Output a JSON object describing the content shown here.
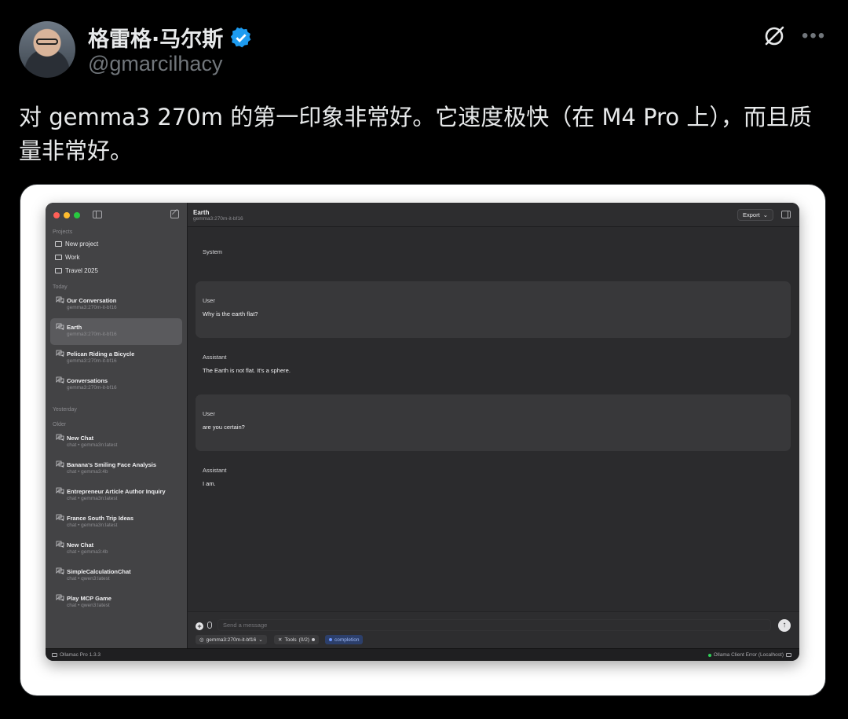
{
  "tweet": {
    "display_name": "格雷格·马尔斯",
    "handle": "@gmarcilhacy",
    "text": "对 gemma3 270m 的第一印象非常好。它速度极快（在 M4 Pro 上），而且质量非常好。"
  },
  "colors": {
    "verified": "#1d9bf0",
    "sidebar_bg": "#434345",
    "main_bg": "#2b2b2d",
    "active_item": "#5a5a5d",
    "status_ok": "#30d158"
  },
  "sidebar": {
    "projects_label": "Projects",
    "projects": [
      "New project",
      "Work",
      "Travel 2025"
    ],
    "today_label": "Today",
    "today": [
      {
        "title": "Our Conversation",
        "sub": "gemma3:270m-it-bf16"
      },
      {
        "title": "Earth",
        "sub": "gemma3:270m-it-bf16"
      },
      {
        "title": "Pelican Riding a Bicycle",
        "sub": "gemma3:270m-it-bf16"
      },
      {
        "title": "Conversations",
        "sub": "gemma3:270m-it-bf16"
      }
    ],
    "yesterday_label": "Yesterday",
    "older_label": "Older",
    "older": [
      {
        "title": "New Chat",
        "sub": "chat • gemma3n:latest"
      },
      {
        "title": "Banana's Smiling Face Analysis",
        "sub": "chat • gemma3:4b"
      },
      {
        "title": "Entrepreneur Article Author Inquiry",
        "sub": "chat • gemma3n:latest"
      },
      {
        "title": "France South Trip Ideas",
        "sub": "chat • gemma3n:latest"
      },
      {
        "title": "New Chat",
        "sub": "chat • gemma3:4b"
      },
      {
        "title": "SimpleCalculationChat",
        "sub": "chat • qwen3:latest"
      },
      {
        "title": "Play MCP Game",
        "sub": "chat • qwen3:latest"
      }
    ]
  },
  "header": {
    "title": "Earth",
    "model": "gemma3:270m-it-bf16",
    "export_label": "Export"
  },
  "messages": [
    {
      "role": "System",
      "text": ""
    },
    {
      "role": "User",
      "text": "Why is the earth flat?"
    },
    {
      "role": "Assistant",
      "text": "The Earth is not flat. It's a sphere."
    },
    {
      "role": "User",
      "text": "are you certain?"
    },
    {
      "role": "Assistant",
      "text": "I am."
    }
  ],
  "composer": {
    "placeholder": "Send a message",
    "model_chip": "gemma3:270m-it-bf16",
    "tools_label": "Tools",
    "tools_count": "(0/2)",
    "mode_chip": "completion"
  },
  "status": {
    "app_version": "Ollamac Pro 1.3.3",
    "connection": "Ollama Client Error (Localhost)"
  }
}
